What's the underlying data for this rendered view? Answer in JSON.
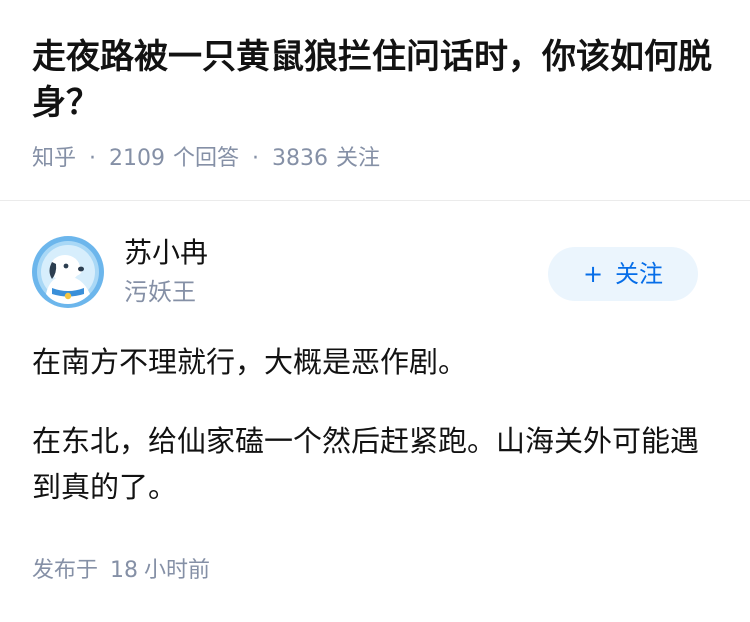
{
  "question": {
    "title": "走夜路被一只黄鼠狼拦住问话时，你该如何脱身？",
    "site": "知乎",
    "answer_count": "2109",
    "answer_label": "个回答",
    "follow_count": "3836",
    "follow_label": "关注",
    "separator": "·"
  },
  "author": {
    "name": "苏小冉",
    "bio": "污妖王",
    "avatar_icon": "cartoon-dog-avatar-icon",
    "follow_button": {
      "plus": "+",
      "label": "关注"
    }
  },
  "answer": {
    "paragraphs": [
      "在南方不理就行，大概是恶作剧。",
      "在东北，给仙家磕一个然后赶紧跑。山海关外可能遇到真的了。"
    ],
    "published_prefix": "发布于",
    "published_value": "18",
    "published_suffix": "小时前"
  },
  "colors": {
    "title_text": "#121212",
    "meta_text": "#8590a6",
    "brand_blue": "#056de8",
    "button_bg": "#ebf5fd",
    "avatar_bg": "#6cb6ec"
  }
}
